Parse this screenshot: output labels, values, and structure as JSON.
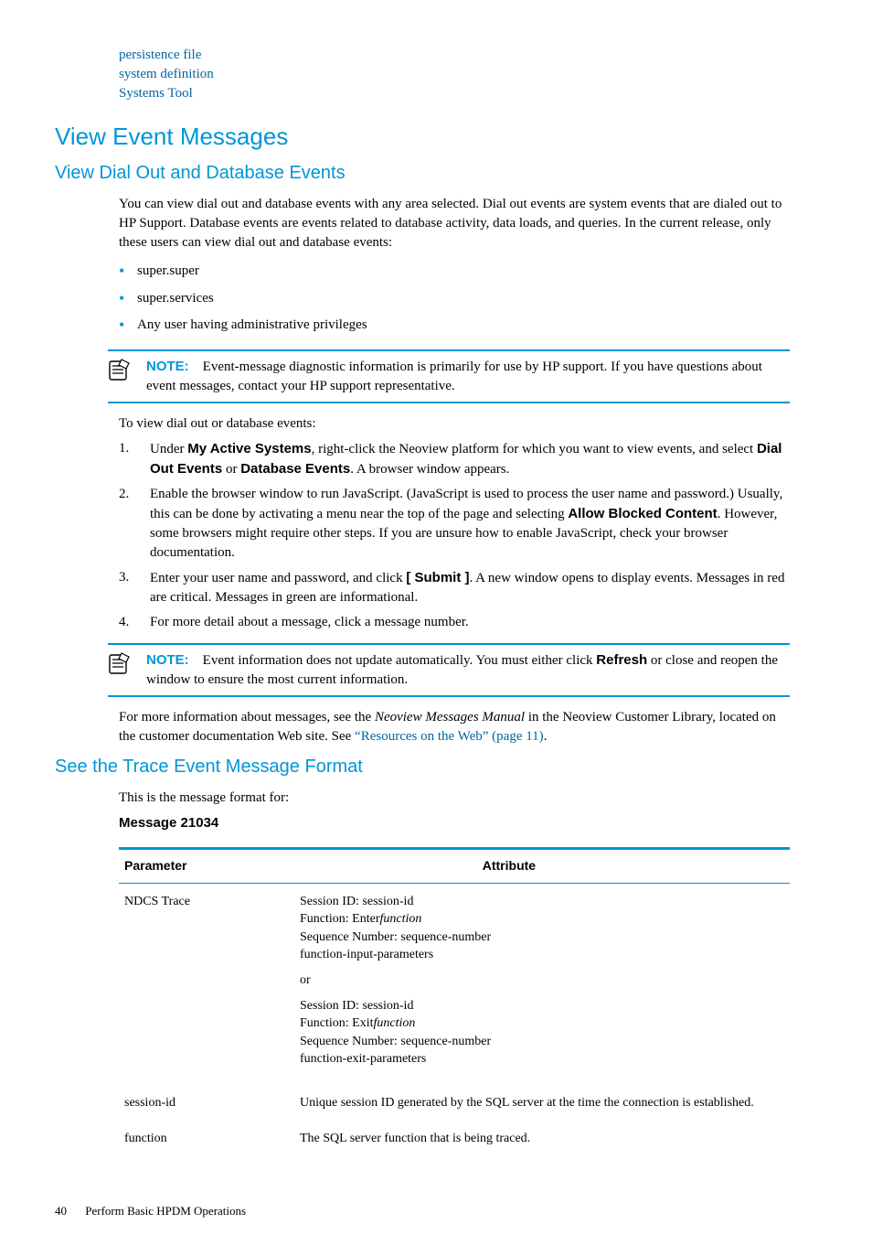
{
  "topLinks": {
    "l1": "persistence file",
    "l2": "system definition",
    "l3": "Systems Tool"
  },
  "h1": "View Event Messages",
  "h2a": "View Dial Out and Database Events",
  "intro": "You can view dial out and database events with any area selected. Dial out events are system events that are dialed out to HP Support. Database events are events related to database activity, data loads, and queries. In the current release, only these users can view dial out and database events:",
  "bullets": {
    "b1": "super.super",
    "b2": "super.services",
    "b3": "Any user having administrative privileges"
  },
  "note1": {
    "label": "NOTE:",
    "text": "Event-message diagnostic information is primarily for use by HP support. If you have questions about event messages, contact your HP support representative."
  },
  "lead": "To view dial out or database events:",
  "steps": {
    "s1num": "1.",
    "s1a": "Under ",
    "s1b": "My Active Systems",
    "s1c": ", right-click the Neoview platform for which you want to view events, and select ",
    "s1d": "Dial Out Events",
    "s1e": " or ",
    "s1f": "Database Events",
    "s1g": ". A browser window appears.",
    "s2num": "2.",
    "s2a": "Enable the browser window to run JavaScript. (JavaScript is used to process the user name and password.) Usually, this can be done by activating a menu near the top of the page and selecting ",
    "s2b": "Allow Blocked Content",
    "s2c": ". However, some browsers might require other steps. If you are unsure how to enable JavaScript, check your browser documentation.",
    "s3num": "3.",
    "s3a": "Enter your user name and password, and click ",
    "s3b": "[ Submit ]",
    "s3c": ". A new window opens to display events. Messages in red are critical. Messages in green are informational.",
    "s4num": "4.",
    "s4a": "For more detail about a message, click a message number."
  },
  "note2": {
    "label": "NOTE:",
    "text_a": "Event information does not update automatically. You must either click ",
    "text_b": "Refresh",
    "text_c": " or close and reopen the window to ensure the most current information."
  },
  "moreinfo_a": "For more information about messages, see the ",
  "moreinfo_b": "Neoview Messages Manual",
  "moreinfo_c": " in the Neoview Customer Library, located on the customer documentation Web site. See ",
  "moreinfo_link": "“Resources on the Web” (page 11)",
  "moreinfo_d": ".",
  "h2b": "See the Trace Event Message Format",
  "format_intro": "This is the message format for:",
  "msgnum": "Message 21034",
  "table": {
    "h1": "Parameter",
    "h2": "Attribute",
    "r1p": "NDCS Trace",
    "r1a1": "Session ID: session-id",
    "r1a2a": "Function: Enter",
    "r1a2b": "function",
    "r1a3": "Sequence Number: sequence-number",
    "r1a4": "function-input-parameters",
    "r1or": "or",
    "r1b1": "Session ID: session-id",
    "r1b2a": "Function: Exit",
    "r1b2b": "function",
    "r1b3": "Sequence Number: sequence-number",
    "r1b4": "function-exit-parameters",
    "r2p": "session-id",
    "r2a": "Unique session ID generated by the SQL server at the time the connection is established.",
    "r3p": "function",
    "r3a": "The SQL server function that is being traced."
  },
  "footer": {
    "page": "40",
    "chapter": "Perform Basic HPDM Operations"
  }
}
